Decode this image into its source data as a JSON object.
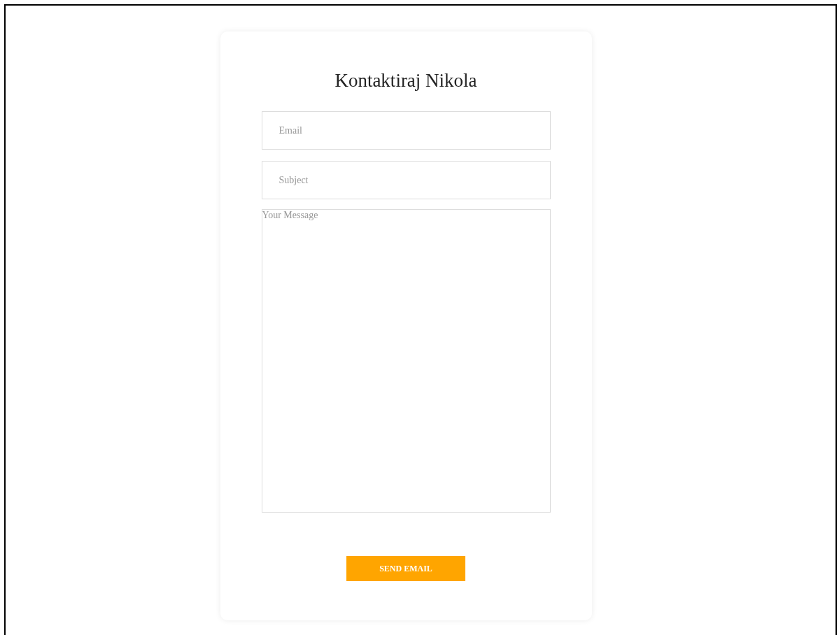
{
  "form": {
    "title": "Kontaktiraj Nikola",
    "fields": [
      {
        "kind": "input",
        "placeholder": "Email"
      },
      {
        "kind": "input",
        "placeholder": "Subject"
      },
      {
        "kind": "textarea",
        "placeholder": "Your Message"
      }
    ],
    "button": "SEND EMAIL"
  }
}
